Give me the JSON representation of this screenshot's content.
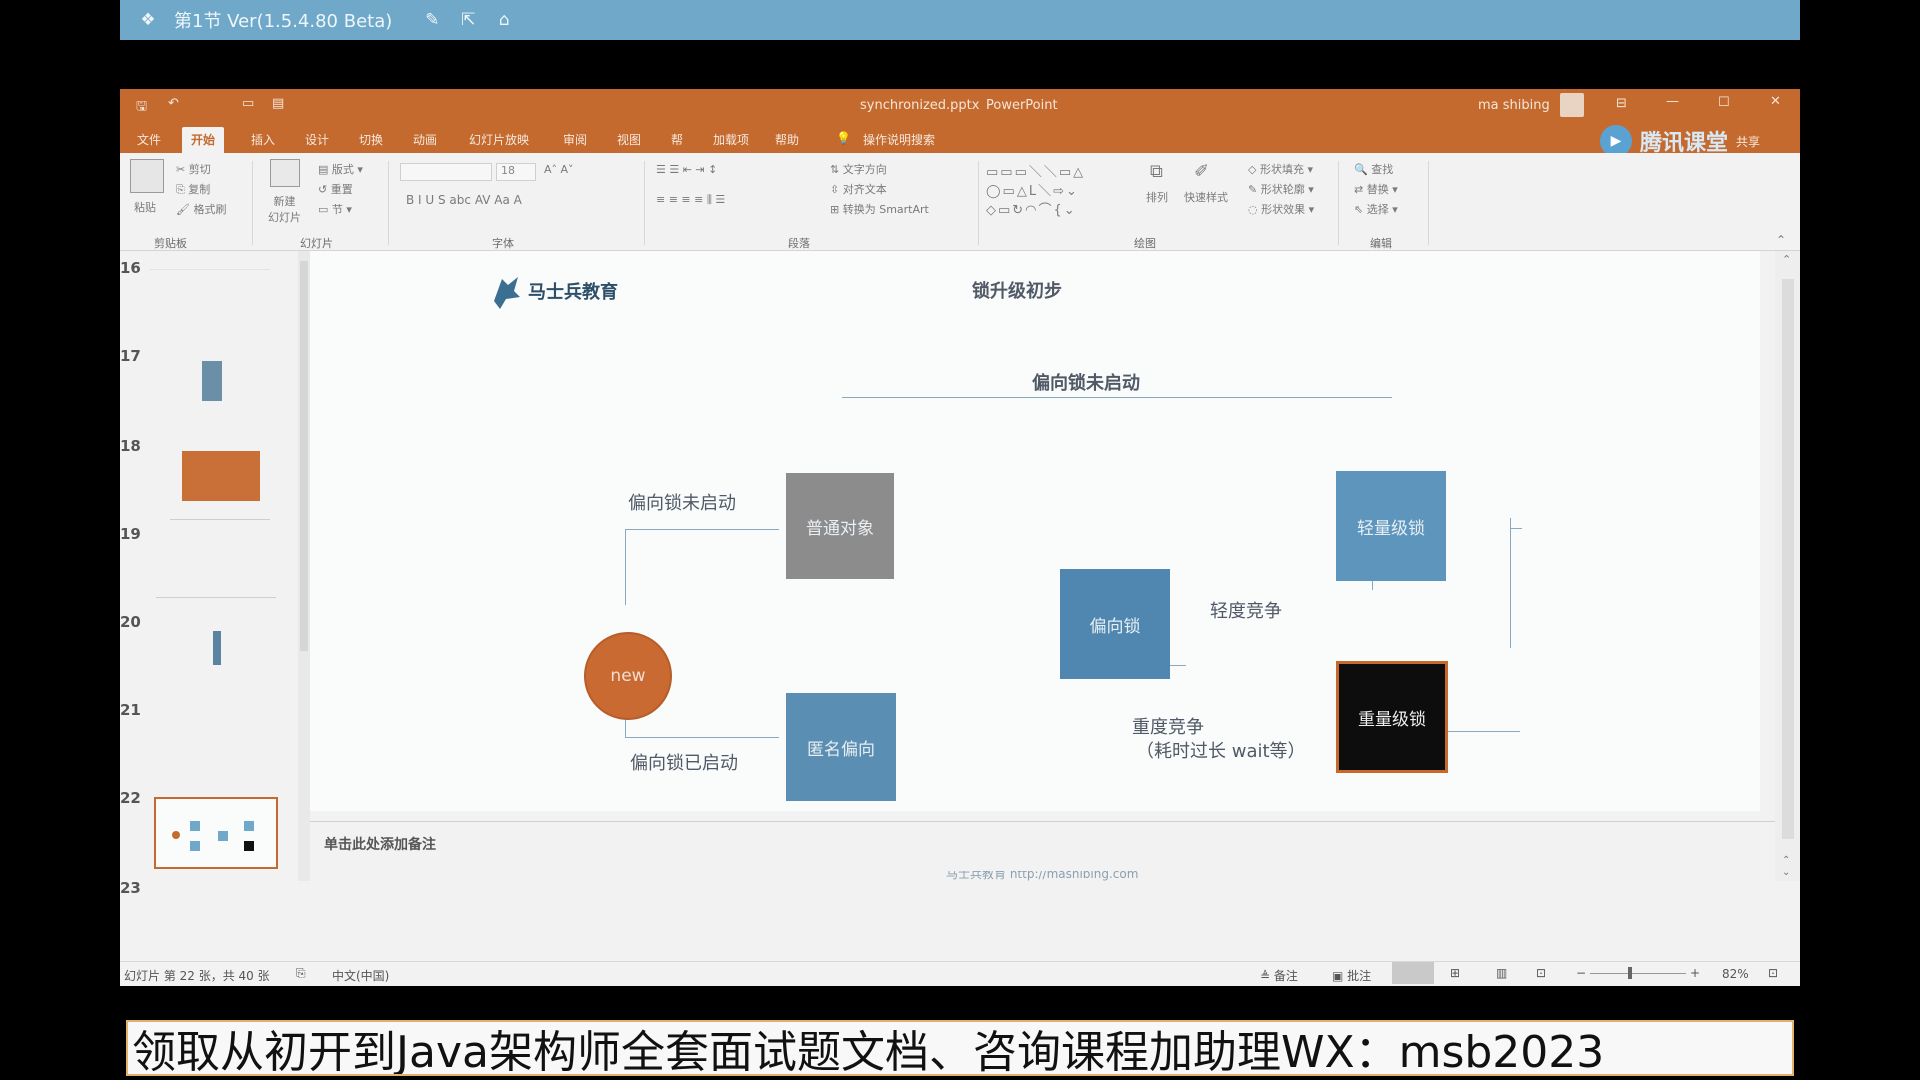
{
  "topbar": {
    "title": "第1节 Ver(1.5.4.80 Beta)",
    "icons": [
      "app-logo-icon",
      "edit-icon",
      "share-icon",
      "home-icon"
    ]
  },
  "ppt": {
    "filename": "synchronized.pptx",
    "app": "PowerPoint",
    "user": "ma shibing",
    "share_label": "共享",
    "tencent_label": "腾讯课堂",
    "tabs": [
      "文件",
      "开始",
      "插入",
      "设计",
      "切换",
      "动画",
      "幻灯片放映",
      "审阅",
      "视图",
      "帮",
      "加载项",
      "帮助",
      "操作说明搜索"
    ],
    "active_tab": "开始",
    "ribbon": {
      "clipboard": {
        "paste": "粘贴",
        "cut": "剪切",
        "copy": "复制",
        "format_painter": "格式刷",
        "group": "剪贴板"
      },
      "slides": {
        "new_slide": "新建\n幻灯片",
        "layout": "版式",
        "reset": "重置",
        "section": "节",
        "group": "幻灯片"
      },
      "font": {
        "size": "18",
        "group": "字体"
      },
      "paragraph": {
        "text_dir": "文字方向",
        "align_text": "对齐文本",
        "smartart": "转换为 SmartArt",
        "group": "段落"
      },
      "drawing": {
        "arrange": "排列",
        "quick_styles": "快速样式",
        "fill": "形状填充",
        "outline": "形状轮廓",
        "effects": "形状效果",
        "group": "绘图"
      },
      "editing": {
        "find": "查找",
        "replace": "替换",
        "select": "选择",
        "group": "编辑"
      }
    },
    "thumb_numbers": [
      "16",
      "17",
      "18",
      "19",
      "20",
      "21",
      "22",
      "23"
    ],
    "slide": {
      "logo_text": "马士兵教育",
      "title": "锁升级初步",
      "subtitle": "偏向锁未启动",
      "new_label": "new",
      "edge_top": "偏向锁未启动",
      "edge_bottom": "偏向锁已启动",
      "normal_obj": "普通对象",
      "anon_bias": "匿名偏向",
      "bias_lock": "偏向锁",
      "light_lock": "轻量级锁",
      "heavy_lock": "重量级锁",
      "light_contention": "轻度竞争",
      "heavy_contention": "重度竞争",
      "heavy_note": "（耗时过长 wait等）",
      "footer": "马士兵教育 http://mashibing.com"
    },
    "notes_placeholder": "单击此处添加备注",
    "status": {
      "slide_info": "幻灯片 第 22 张，共 40 张",
      "language": "中文(中国)",
      "notes": "备注",
      "comments": "批注",
      "zoom": "82%"
    }
  },
  "banner": {
    "text": "领取从初开到Java架构师全套面试题文档、咨询课程加助理WX：msb2023"
  }
}
